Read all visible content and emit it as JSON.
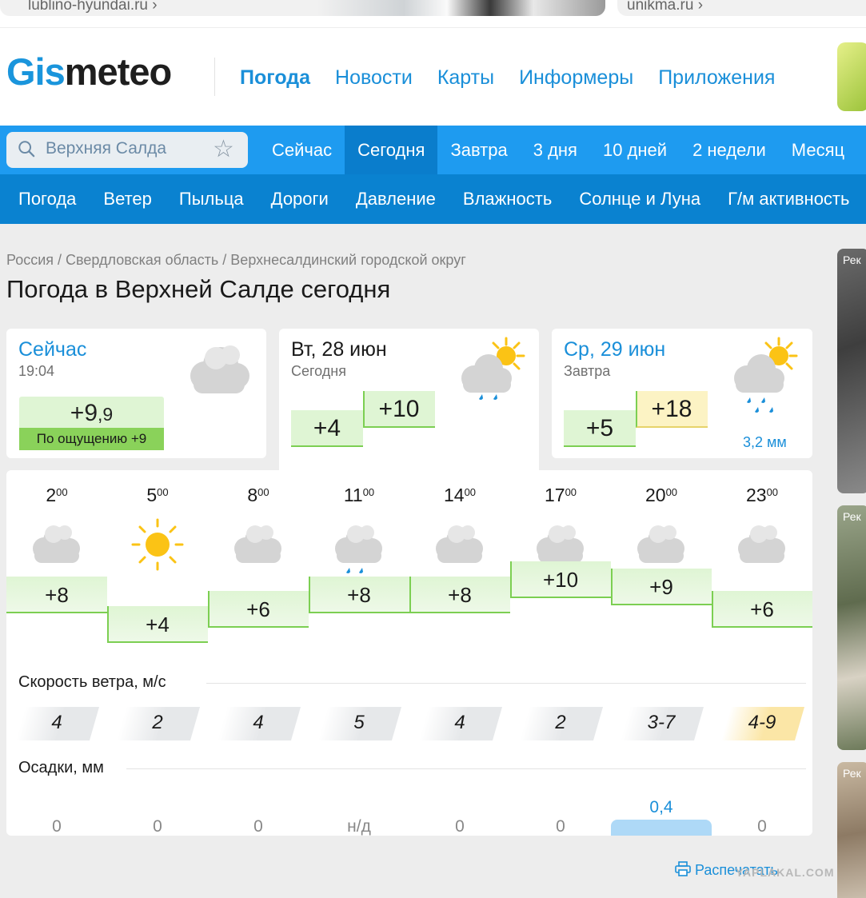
{
  "top_ads": [
    "lublino-hyundai.ru ›",
    "unikma.ru ›"
  ],
  "logo": {
    "part1": "Gis",
    "part2": "meteo"
  },
  "main_nav": [
    "Погода",
    "Новости",
    "Карты",
    "Информеры",
    "Приложения"
  ],
  "search": {
    "value": "Верхняя Салда"
  },
  "period_tabs": [
    "Сейчас",
    "Сегодня",
    "Завтра",
    "3 дня",
    "10 дней",
    "2 недели",
    "Месяц"
  ],
  "sub_nav": [
    "Погода",
    "Ветер",
    "Пыльца",
    "Дороги",
    "Давление",
    "Влажность",
    "Солнце и Луна",
    "Г/м активность"
  ],
  "breadcrumb": [
    "Россия",
    "Свердловская область",
    "Верхнесалдинский городской округ"
  ],
  "title": "Погода в Верхней Салде сегодня",
  "now": {
    "label": "Сейчас",
    "time": "19:04",
    "temp_int": "+9",
    "temp_frac": ",9",
    "feels": "По ощущению +9",
    "icon": "cloud-icon"
  },
  "today": {
    "label": "Вт, 28 июн",
    "sub": "Сегодня",
    "tmin": "+4",
    "tmax": "+10",
    "icon": "sun-cloud-rain-icon"
  },
  "tomorrow": {
    "label": "Ср, 29 июн",
    "sub": "Завтра",
    "tmin": "+5",
    "tmax": "+18",
    "precip": "3,2 мм",
    "icon": "sun-cloud-rain-icon"
  },
  "hourly": [
    {
      "hour": "2",
      "min": "00",
      "icon": "cloud-icon",
      "temp": "+8",
      "temp_value": 8,
      "wind": "4",
      "precip": "0",
      "precip_value": 0
    },
    {
      "hour": "5",
      "min": "00",
      "icon": "sun-icon",
      "temp": "+4",
      "temp_value": 4,
      "wind": "2",
      "precip": "0",
      "precip_value": 0
    },
    {
      "hour": "8",
      "min": "00",
      "icon": "cloud-icon",
      "temp": "+6",
      "temp_value": 6,
      "wind": "4",
      "precip": "0",
      "precip_value": 0
    },
    {
      "hour": "11",
      "min": "00",
      "icon": "cloud-rain-icon",
      "temp": "+8",
      "temp_value": 8,
      "wind": "5",
      "precip": "н/д",
      "precip_value": 0
    },
    {
      "hour": "14",
      "min": "00",
      "icon": "cloud-icon",
      "temp": "+8",
      "temp_value": 8,
      "wind": "4",
      "precip": "0",
      "precip_value": 0
    },
    {
      "hour": "17",
      "min": "00",
      "icon": "cloud-icon",
      "temp": "+10",
      "temp_value": 10,
      "wind": "2",
      "precip": "0",
      "precip_value": 0
    },
    {
      "hour": "20",
      "min": "00",
      "icon": "cloud-rain-icon",
      "temp": "+9",
      "temp_value": 9,
      "wind": "3-7",
      "precip": "0,4",
      "precip_value": 0.4
    },
    {
      "hour": "23",
      "min": "00",
      "icon": "cloud-icon",
      "temp": "+6",
      "temp_value": 6,
      "wind": "4-9",
      "wind_high": true,
      "precip": "0",
      "precip_value": 0
    }
  ],
  "wind_label": "Скорость ветра, м/с",
  "precip_label": "Осадки, мм",
  "print_label": "Распечатать",
  "right_ads": [
    "Рек",
    "Рек",
    "Рек"
  ],
  "watermark": "YAPLAKAL.COM",
  "colors": {
    "accent": "#1a95dc",
    "tab_bar": "#1e9bf0",
    "subnav_bar": "#0a82d0",
    "temp_fill": "#dff5d4",
    "temp_line": "#7ccf52",
    "warm_fill": "#fcf3c4",
    "rain": "#1a8fd9",
    "sun": "#fbc315"
  }
}
